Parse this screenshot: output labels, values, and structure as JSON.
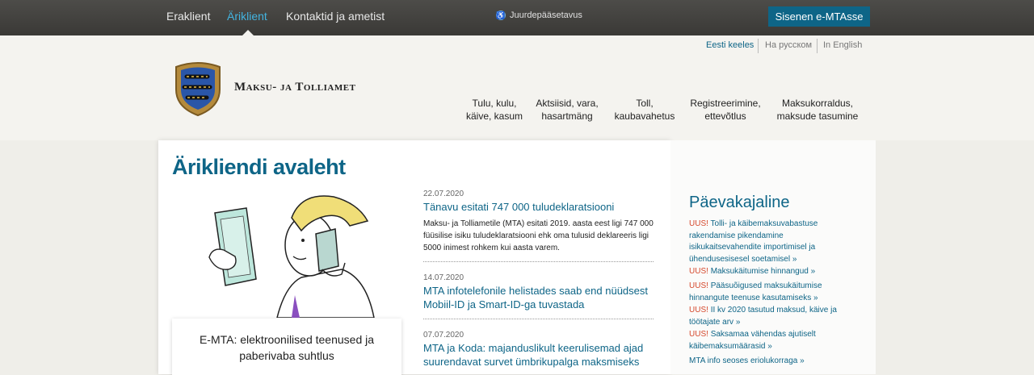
{
  "topnav": {
    "items": [
      {
        "label": "Eraklient"
      },
      {
        "label": "Äriklient"
      },
      {
        "label": "Kontaktid ja ametist"
      }
    ],
    "accessibility": "Juurdepääsetavus",
    "emta_button": "Sisenen e-MTAsse"
  },
  "languages": [
    "Eesti keeles",
    "На русском",
    "In English"
  ],
  "brand": "Maksu- ja Tolliamet",
  "mainnav": [
    {
      "label": "Tulu, kulu,\nkäive, kasum"
    },
    {
      "label": "Aktsiisid, vara,\nhasartmäng"
    },
    {
      "label": "Toll,\nkaubavahetus"
    },
    {
      "label": "Registreerimine,\nettevõtlus"
    },
    {
      "label": "Maksukorraldus,\nmaksude tasumine"
    }
  ],
  "page_title": "Ärikliendi avaleht",
  "emta_box": "E-MTA: elektroonilised teenused ja paberivaba suhtlus",
  "news": [
    {
      "date": "22.07.2020",
      "title": "Tänavu esitati 747 000 tuludeklaratsiooni",
      "body": "Maksu- ja Tolliametile (MTA) esitati 2019. aasta eest ligi 747 000 füüsilise isiku tuludeklaratsiooni ehk oma tulusid deklareeris ligi 5000 inimest rohkem kui aasta varem."
    },
    {
      "date": "14.07.2020",
      "title": "MTA infotelefonile helistades saab end nüüdsest Mobiil-ID ja Smart-ID-ga tuvastada",
      "body": ""
    },
    {
      "date": "07.07.2020",
      "title": "MTA ja Koda: majanduslikult keerulisemad ajad suurendavat survet ümbrikupalga maksmiseks",
      "body": ""
    }
  ],
  "sidebar": {
    "title": "Päevakajaline",
    "new_label": "UUS!",
    "items": [
      {
        "text": "Tolli- ja käibemaksuvabastuse rakendamise pikendamine isikukaitsevahendite importimisel ja ühendusesisesel soetamisel »"
      },
      {
        "text": "Maksukäitumise hinnangud »"
      },
      {
        "text": "Pääsuõigused maksukäitumise hinnangute teenuse kasutamiseks »"
      },
      {
        "text": "II kv 2020 tasutud maksud, käive ja töötajate arv »"
      },
      {
        "text": "Saksamaa vähendas ajutiselt käibemaksumäärasid »"
      },
      {
        "text": "MTA info seoses eriolukorraga »"
      }
    ]
  },
  "colors": {
    "accent": "#0e6587",
    "new_badge": "#d5472b",
    "active_nav": "#43b4e0"
  }
}
